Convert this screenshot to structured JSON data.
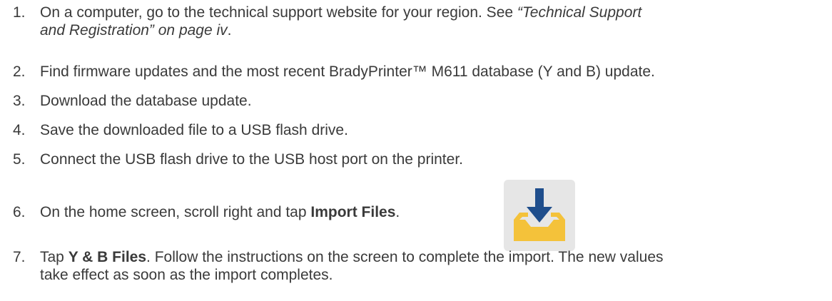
{
  "steps": [
    {
      "number": "1.",
      "line1": "On a computer, go to the technical support website for your region. See ",
      "line1_link": "“Technical Support",
      "line2_link": "and Registration” on page iv",
      "line2_end": "."
    },
    {
      "number": "2.",
      "text": "Find firmware updates and the most recent BradyPrinter™ M611 database (Y and B) update."
    },
    {
      "number": "3.",
      "text": "Download the database update."
    },
    {
      "number": "4.",
      "text": "Save the downloaded file to a USB flash drive."
    },
    {
      "number": "5.",
      "text": "Connect the USB flash drive to the USB host port on the printer."
    },
    {
      "number": "6.",
      "text_before": "On the home screen, scroll right and tap ",
      "bold": "Import Files",
      "text_after": "."
    },
    {
      "number": "7.",
      "text_before": "Tap ",
      "bold": "Y & B Files",
      "line1_after": ". Follow the instructions on the screen to complete the import. The new values",
      "line2": "take effect as soon as the import completes."
    }
  ],
  "icons": {
    "import_icon": "import-files-icon",
    "tray_color": "#f4c23a",
    "arrow_color": "#1f4e8c",
    "tile_color": "#e6e6e6"
  }
}
